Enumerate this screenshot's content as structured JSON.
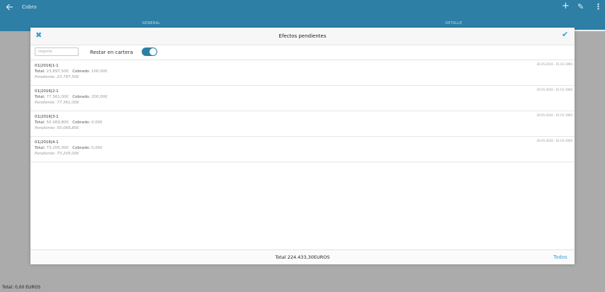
{
  "appbar": {
    "title": "Cobro",
    "back_icon": "arrow-left-icon",
    "actions": [
      "plus-icon",
      "pencil-icon",
      "more-vertical-icon"
    ]
  },
  "tabs": [
    {
      "label": "GENERAL"
    },
    {
      "label": "DETALLE"
    }
  ],
  "colors": {
    "primary": "#2d7fa6",
    "accent": "#3a9bd6"
  },
  "modal": {
    "title": "Efectos pendientes",
    "filter": {
      "importe_placeholder": "Importe",
      "restar_label": "Restar en cartera",
      "restar_on": true
    },
    "items": [
      {
        "ref": "01|2016|1-1",
        "total_label": "Total:",
        "total": "23.897,50€",
        "cobrado_label": "Cobrado:",
        "cobrado": "100,00€",
        "pendiente": "Pendiente: 23.797,50€",
        "dates": "20-05-2016 - 01-01-1900"
      },
      {
        "ref": "01|2016|2-1",
        "total_label": "Total:",
        "total": "77.561,00€",
        "cobrado_label": "Cobrado:",
        "cobrado": "200,00€",
        "pendiente": "Pendiente: 77.361,00€",
        "dates": "20-05-2016 - 01-01-1900"
      },
      {
        "ref": "01|2016|3-1",
        "total_label": "Total:",
        "total": "50.069,80€",
        "cobrado_label": "Cobrado:",
        "cobrado": "0,00€",
        "pendiente": "Pendiente: 50.069,80€",
        "dates": "20-05-2016 - 01-01-1900"
      },
      {
        "ref": "01|2016|4-1",
        "total_label": "Total:",
        "total": "73.205,00€",
        "cobrado_label": "Cobrado:",
        "cobrado": "0,00€",
        "pendiente": "Pendiente: 73.205,00€",
        "dates": "20-05-2016 - 01-01-1900"
      }
    ],
    "footer": {
      "total": "Total 224.433,30EUROS",
      "todos": "Todos"
    }
  },
  "bottom": {
    "total": "Total: 0,00 EUROS"
  }
}
